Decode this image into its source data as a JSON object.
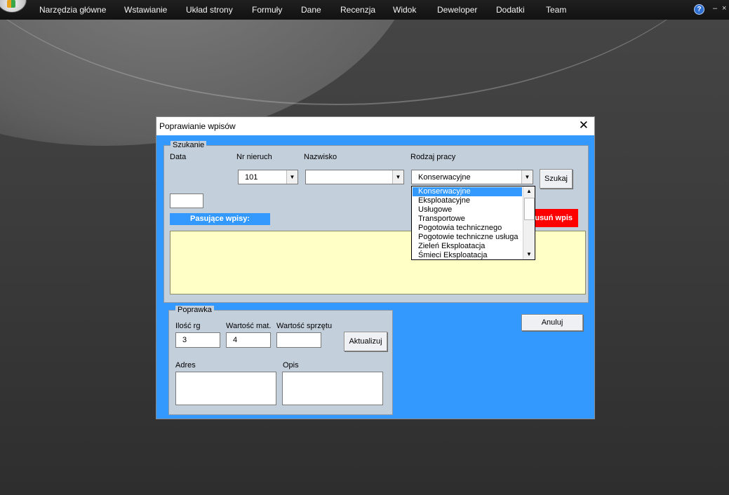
{
  "menubar": {
    "items": [
      "Narzędzia główne",
      "Wstawianie",
      "Układ strony",
      "Formuły",
      "Dane",
      "Recenzja",
      "Widok",
      "Deweloper",
      "Dodatki",
      "Team"
    ],
    "help_icon": "?",
    "minimize_icon": "–",
    "restore_icon": "▭",
    "close_icon": "×"
  },
  "dialog": {
    "title": "Poprawianie wpisów",
    "close_icon": "✕",
    "search": {
      "frame_title": "Szukanie",
      "date_label": "Data",
      "property_label": "Nr nieruch",
      "property_value": "101",
      "surname_label": "Nazwisko",
      "surname_value": "",
      "work_type_label": "Rodzaj pracy",
      "work_type_value": "Konserwacyjne",
      "search_button": "Szukaj",
      "date_value": "",
      "results_header": "Pasujące wpisy:",
      "delete_button": "usuń wpis",
      "dropdown_options": [
        "Konserwacyjne",
        "Eksploatacyjne",
        "Usługowe",
        "Transportowe",
        "Pogotowia technicznego",
        "Pogotowie techniczne usługa",
        "Zieleń Eksploatacja",
        "Śmieci Eksploatacja"
      ],
      "dropdown_selected_index": 0
    },
    "correction": {
      "frame_title": "Poprawka",
      "qty_label": "Ilość rg",
      "qty_value": "3",
      "material_label": "Wartość mat.",
      "material_value": "4",
      "equipment_label": "Wartość sprzętu",
      "equipment_value": "",
      "update_button": "Aktualizuj",
      "address_label": "Adres",
      "address_value": "",
      "description_label": "Opis",
      "description_value": ""
    },
    "cancel_button": "Anuluj"
  }
}
